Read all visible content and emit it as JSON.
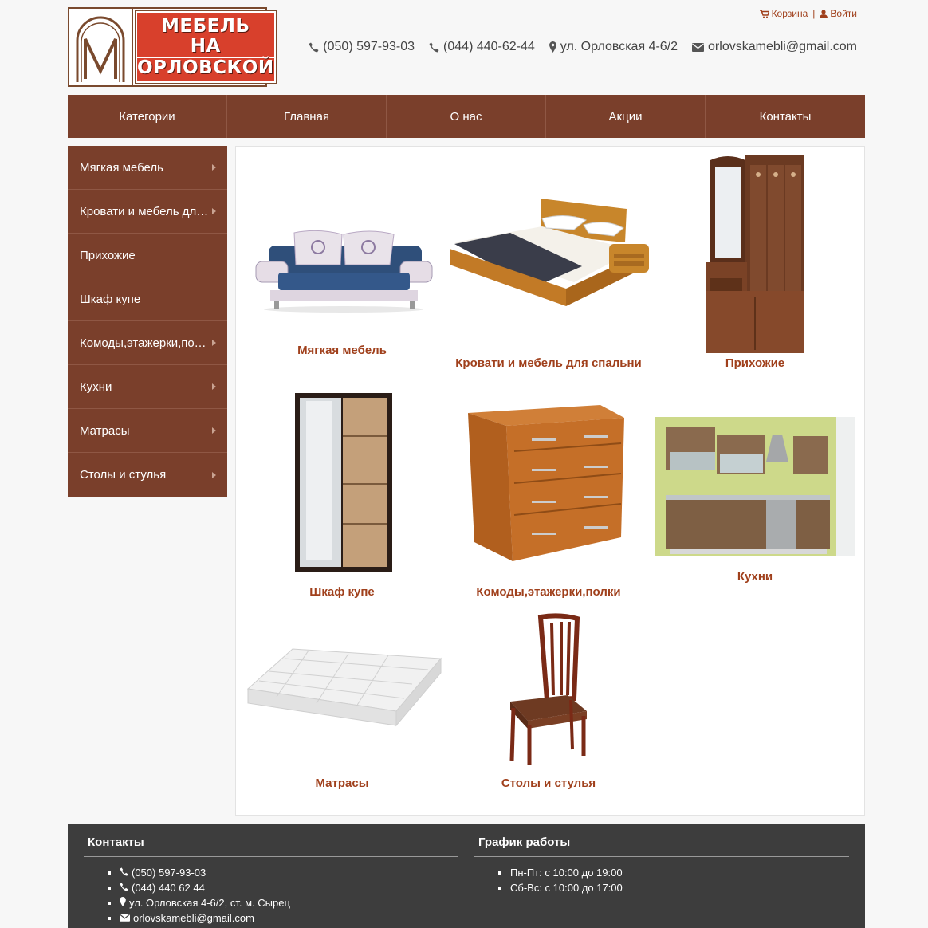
{
  "header": {
    "logo_lines": [
      "МЕБЕЛЬ",
      "НА",
      "ОРЛОВСКОЙ"
    ],
    "cart_label": "Корзина",
    "login_label": "Войти",
    "separator": "|",
    "phone1": "(050) 597-93-03",
    "phone2": "(044) 440-62-44",
    "address": "ул. Орловская 4-6/2",
    "email": "orlovskamebli@gmail.com"
  },
  "nav": {
    "items": [
      "Категории",
      "Главная",
      "О нас",
      "Акции",
      "Контакты"
    ]
  },
  "sidebar": {
    "items": [
      "Мягкая мебель",
      "Кровати и мебель для спальни",
      "Прихожие",
      "Шкаф купе",
      "Комоды,этажерки,полки",
      "Кухни",
      "Матрасы",
      "Столы и стулья"
    ]
  },
  "categories": [
    "Мягкая мебель",
    "Кровати и мебель для спальни",
    "Прихожие",
    "Шкаф купе",
    "Комоды,этажерки,полки",
    "Кухни",
    "Матрасы",
    "Столы и стулья"
  ],
  "footer": {
    "contacts_title": "Контакты",
    "contacts": [
      "(050) 597-93-03",
      "(044) 440 62 44",
      "ул. Орловская 4-6/2, ст. м. Сырец",
      "orlovskamebli@gmail.com"
    ],
    "schedule_title": "График работы",
    "schedule": [
      "Пн-Пт: с 10:00 до 19:00",
      "Сб-Вс: с 10:00 до 17:00"
    ]
  },
  "colors": {
    "brand_brown": "#7a3f2b",
    "link_rust": "#a0401c",
    "logo_red": "#d8402c",
    "footer_bg": "#3d3d3d"
  }
}
